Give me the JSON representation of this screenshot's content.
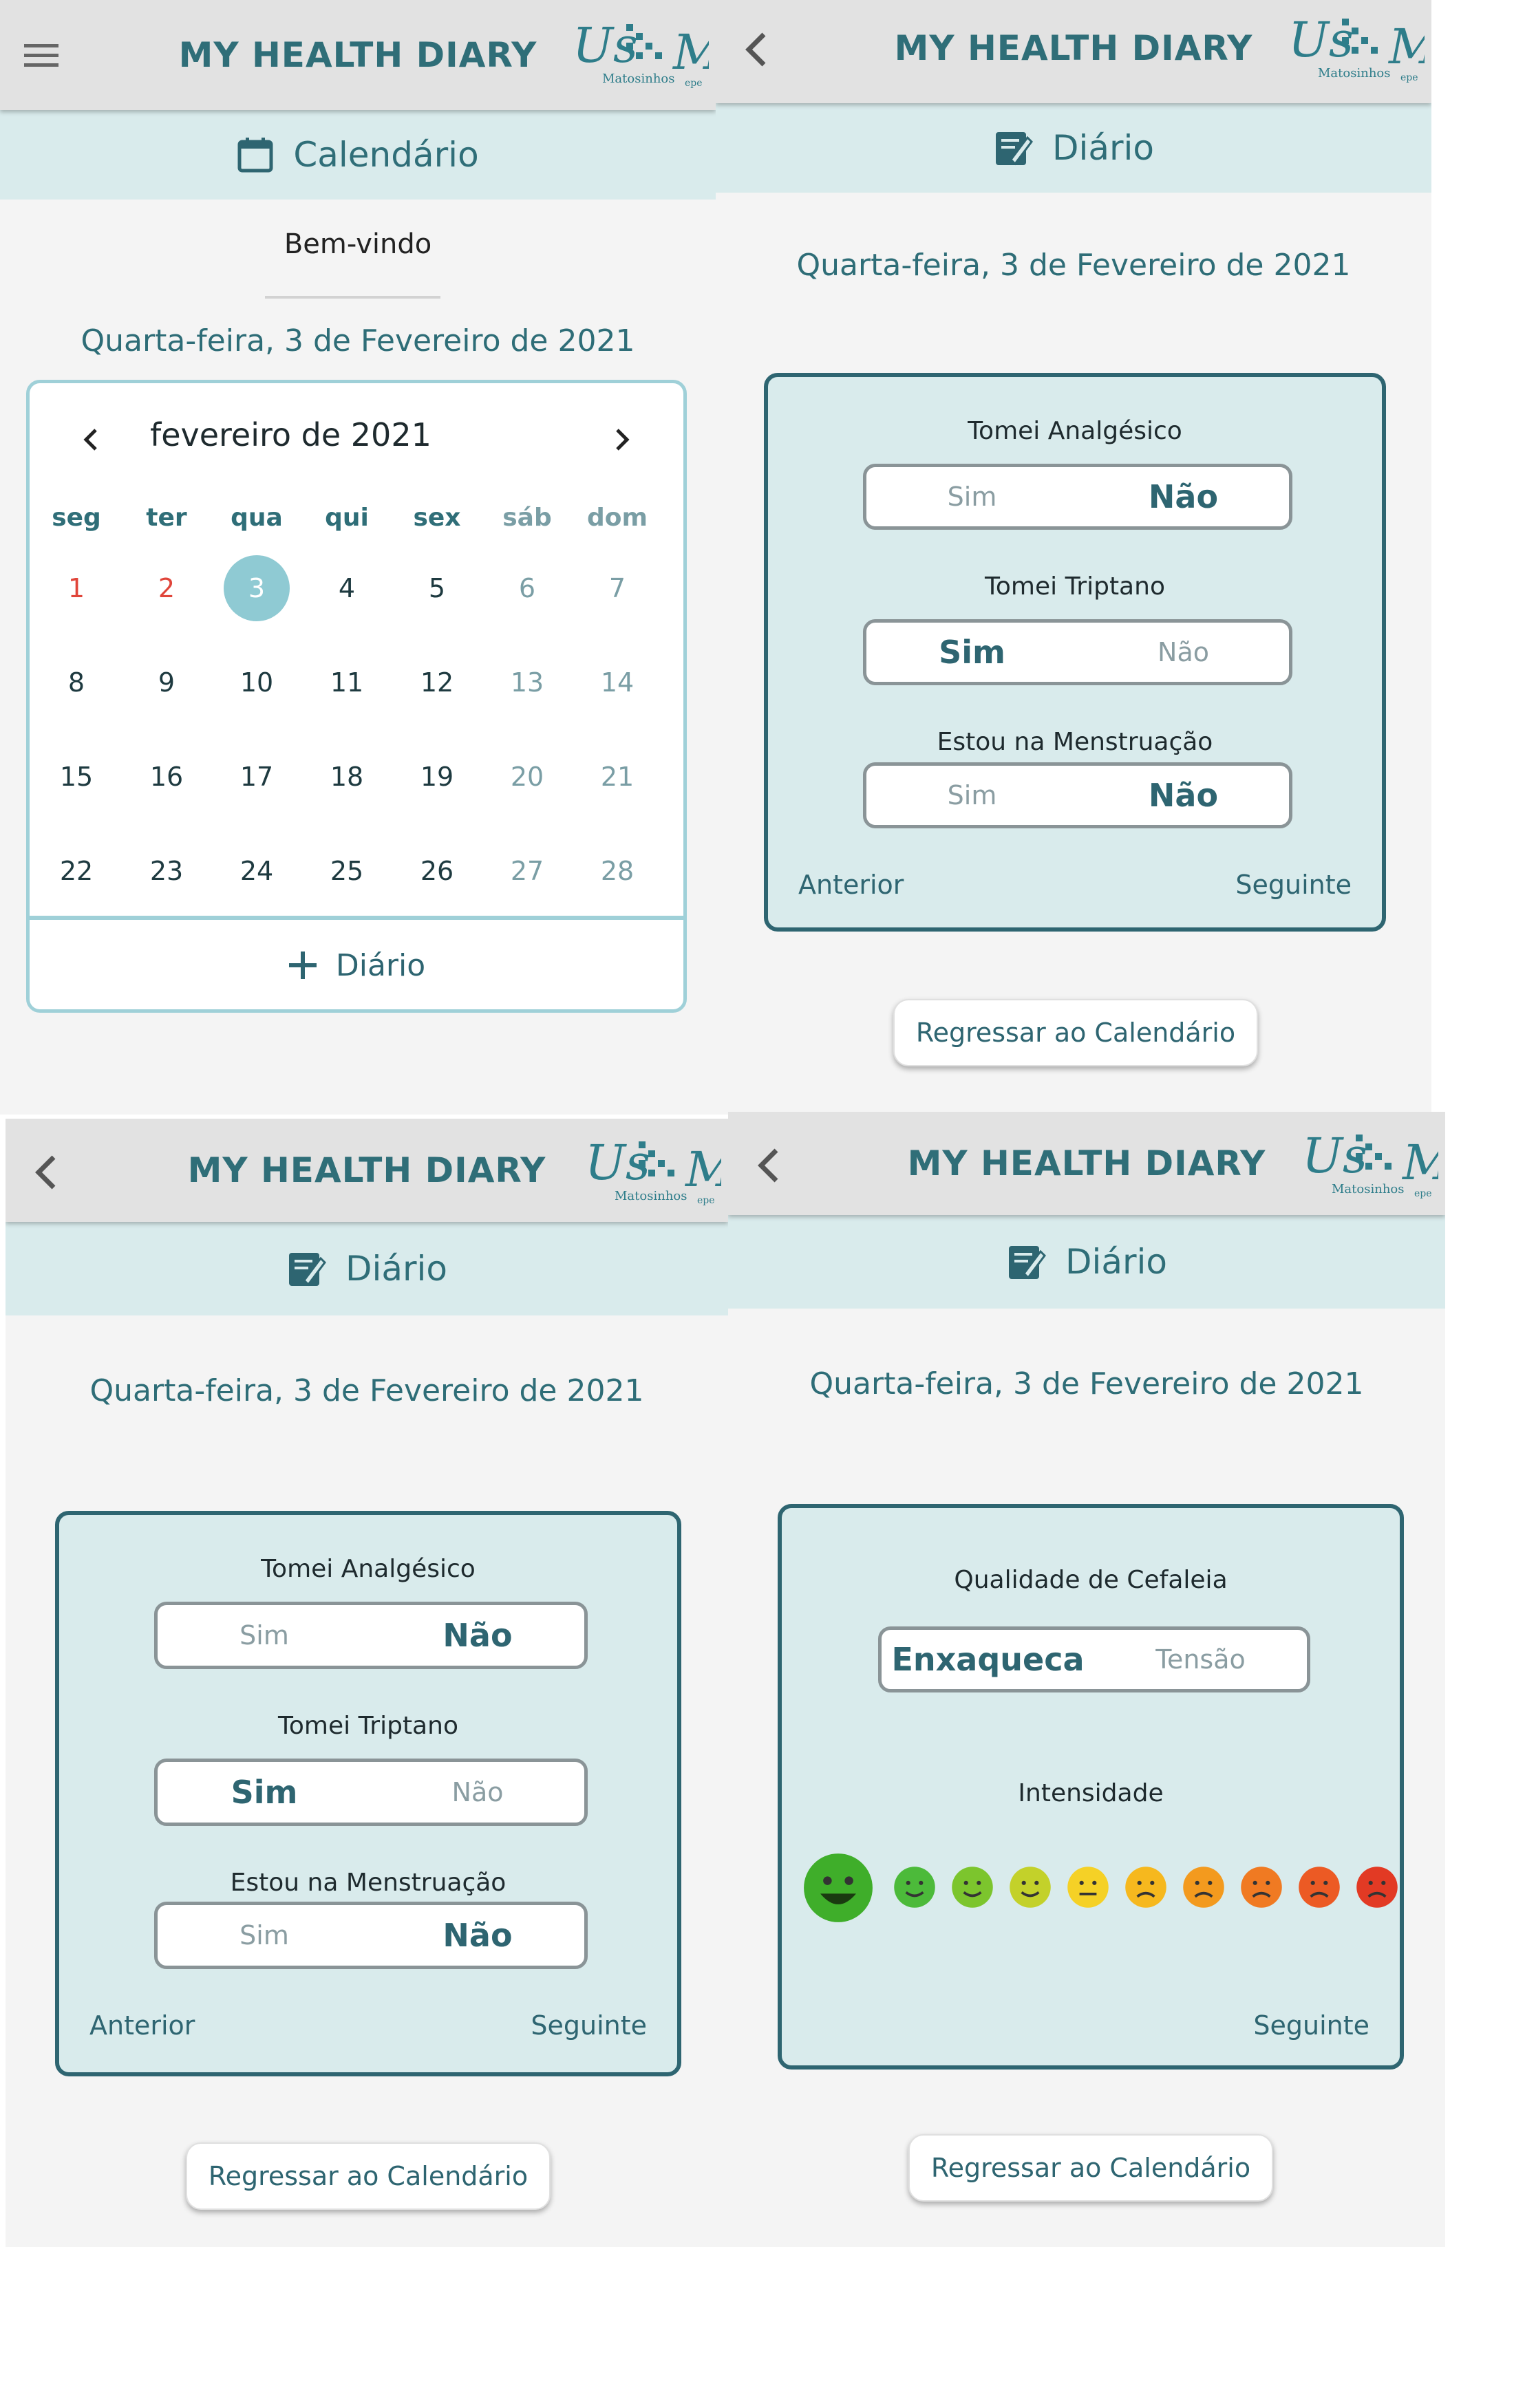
{
  "app": {
    "title": "MY HEALTH DIARY",
    "logo_text": "US",
    "logo_sub": "Matosinhos",
    "logo_suffix": "epe"
  },
  "colors": {
    "teal": "#2e6571",
    "light": "#d9ebec",
    "selected": "#8fcad3",
    "red": "#e0453a"
  },
  "panel1": {
    "nav_icon": "menu-icon",
    "section": "Calendário",
    "section_icon": "calendar-icon",
    "welcome": "Bem-vindo",
    "date": "Quarta-feira, 3 de Fevereiro de 2021",
    "month": "fevereiro de 2021",
    "weekdays": [
      "seg",
      "ter",
      "qua",
      "qui",
      "sex",
      "sáb",
      "dom"
    ],
    "weeks": [
      [
        "1",
        "2",
        "3",
        "4",
        "5",
        "6",
        "7"
      ],
      [
        "8",
        "9",
        "10",
        "11",
        "12",
        "13",
        "14"
      ],
      [
        "15",
        "16",
        "17",
        "18",
        "19",
        "20",
        "21"
      ],
      [
        "22",
        "23",
        "24",
        "25",
        "26",
        "27",
        "28"
      ]
    ],
    "selected_day": "3",
    "add_label": "Diário"
  },
  "panel2": {
    "section": "Diário",
    "date": "Quarta-feira, 3 de Fevereiro de 2021",
    "q1": {
      "label": "Tomei Analgésico",
      "yes": "Sim",
      "no": "Não",
      "value": "Não"
    },
    "q2": {
      "label": "Tomei Triptano",
      "yes": "Sim",
      "no": "Não",
      "value": "Sim"
    },
    "q3": {
      "label": "Estou na Menstruação",
      "yes": "Sim",
      "no": "Não",
      "value": "Não"
    },
    "prev": "Anterior",
    "next": "Seguinte",
    "back": "Regressar ao Calendário"
  },
  "panel3": {
    "section": "Diário",
    "date": "Quarta-feira, 3 de Fevereiro de 2021",
    "q1": {
      "label": "Tomei Analgésico",
      "yes": "Sim",
      "no": "Não",
      "value": "Não"
    },
    "q2": {
      "label": "Tomei Triptano",
      "yes": "Sim",
      "no": "Não",
      "value": "Sim"
    },
    "q3": {
      "label": "Estou na Menstruação",
      "yes": "Sim",
      "no": "Não",
      "value": "Não"
    },
    "prev": "Anterior",
    "next": "Seguinte",
    "back": "Regressar ao Calendário"
  },
  "panel4": {
    "section": "Diário",
    "date": "Quarta-feira, 3 de Fevereiro de 2021",
    "quality": {
      "label": "Qualidade de Cefaleia",
      "a": "Enxaqueca",
      "b": "Tensão",
      "value": "Enxaqueca"
    },
    "intensity_label": "Intensidade",
    "intensity_selected": 1,
    "intensity_colors": [
      "#3fae2a",
      "#4cba3a",
      "#7cc52d",
      "#c3d12a",
      "#f5d126",
      "#f6b81e",
      "#f39a1e",
      "#f07a22",
      "#ec5a24",
      "#e23a24"
    ],
    "next": "Seguinte",
    "back": "Regressar ao Calendário"
  }
}
